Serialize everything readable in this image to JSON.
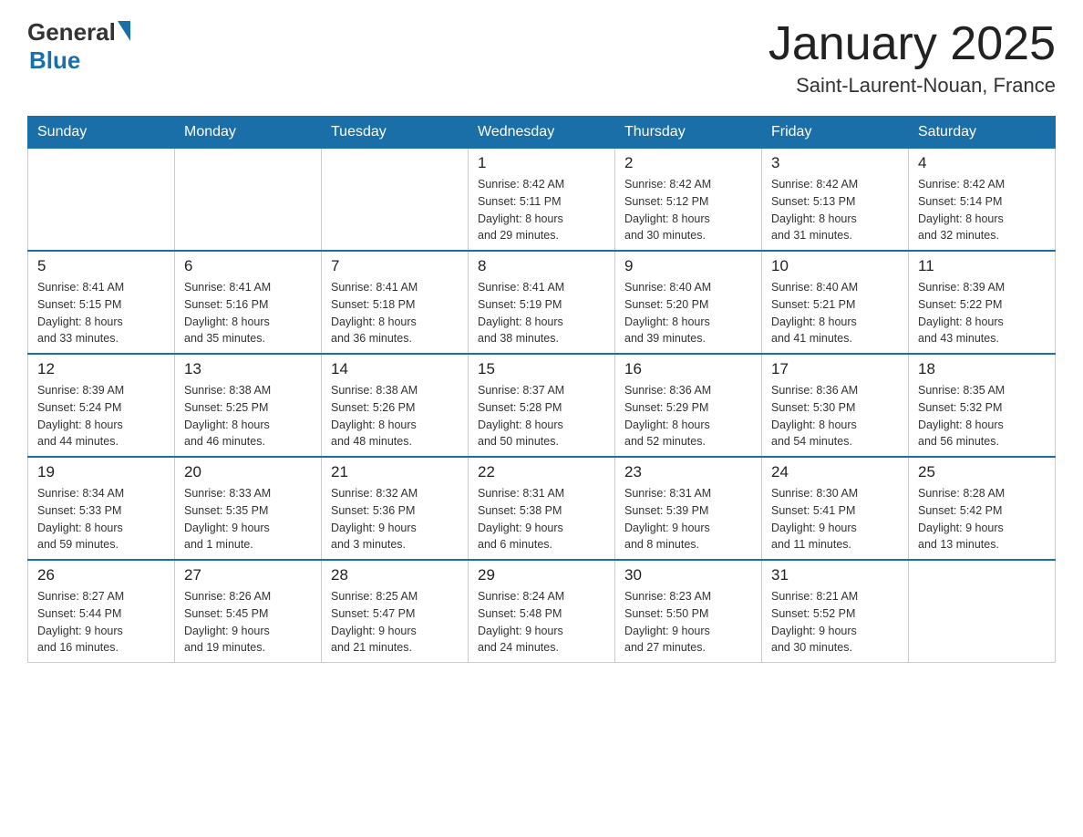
{
  "header": {
    "logo_general": "General",
    "logo_blue": "Blue",
    "month": "January 2025",
    "location": "Saint-Laurent-Nouan, France"
  },
  "days_of_week": [
    "Sunday",
    "Monday",
    "Tuesday",
    "Wednesday",
    "Thursday",
    "Friday",
    "Saturday"
  ],
  "weeks": [
    [
      {
        "day": "",
        "info": ""
      },
      {
        "day": "",
        "info": ""
      },
      {
        "day": "",
        "info": ""
      },
      {
        "day": "1",
        "info": "Sunrise: 8:42 AM\nSunset: 5:11 PM\nDaylight: 8 hours\nand 29 minutes."
      },
      {
        "day": "2",
        "info": "Sunrise: 8:42 AM\nSunset: 5:12 PM\nDaylight: 8 hours\nand 30 minutes."
      },
      {
        "day": "3",
        "info": "Sunrise: 8:42 AM\nSunset: 5:13 PM\nDaylight: 8 hours\nand 31 minutes."
      },
      {
        "day": "4",
        "info": "Sunrise: 8:42 AM\nSunset: 5:14 PM\nDaylight: 8 hours\nand 32 minutes."
      }
    ],
    [
      {
        "day": "5",
        "info": "Sunrise: 8:41 AM\nSunset: 5:15 PM\nDaylight: 8 hours\nand 33 minutes."
      },
      {
        "day": "6",
        "info": "Sunrise: 8:41 AM\nSunset: 5:16 PM\nDaylight: 8 hours\nand 35 minutes."
      },
      {
        "day": "7",
        "info": "Sunrise: 8:41 AM\nSunset: 5:18 PM\nDaylight: 8 hours\nand 36 minutes."
      },
      {
        "day": "8",
        "info": "Sunrise: 8:41 AM\nSunset: 5:19 PM\nDaylight: 8 hours\nand 38 minutes."
      },
      {
        "day": "9",
        "info": "Sunrise: 8:40 AM\nSunset: 5:20 PM\nDaylight: 8 hours\nand 39 minutes."
      },
      {
        "day": "10",
        "info": "Sunrise: 8:40 AM\nSunset: 5:21 PM\nDaylight: 8 hours\nand 41 minutes."
      },
      {
        "day": "11",
        "info": "Sunrise: 8:39 AM\nSunset: 5:22 PM\nDaylight: 8 hours\nand 43 minutes."
      }
    ],
    [
      {
        "day": "12",
        "info": "Sunrise: 8:39 AM\nSunset: 5:24 PM\nDaylight: 8 hours\nand 44 minutes."
      },
      {
        "day": "13",
        "info": "Sunrise: 8:38 AM\nSunset: 5:25 PM\nDaylight: 8 hours\nand 46 minutes."
      },
      {
        "day": "14",
        "info": "Sunrise: 8:38 AM\nSunset: 5:26 PM\nDaylight: 8 hours\nand 48 minutes."
      },
      {
        "day": "15",
        "info": "Sunrise: 8:37 AM\nSunset: 5:28 PM\nDaylight: 8 hours\nand 50 minutes."
      },
      {
        "day": "16",
        "info": "Sunrise: 8:36 AM\nSunset: 5:29 PM\nDaylight: 8 hours\nand 52 minutes."
      },
      {
        "day": "17",
        "info": "Sunrise: 8:36 AM\nSunset: 5:30 PM\nDaylight: 8 hours\nand 54 minutes."
      },
      {
        "day": "18",
        "info": "Sunrise: 8:35 AM\nSunset: 5:32 PM\nDaylight: 8 hours\nand 56 minutes."
      }
    ],
    [
      {
        "day": "19",
        "info": "Sunrise: 8:34 AM\nSunset: 5:33 PM\nDaylight: 8 hours\nand 59 minutes."
      },
      {
        "day": "20",
        "info": "Sunrise: 8:33 AM\nSunset: 5:35 PM\nDaylight: 9 hours\nand 1 minute."
      },
      {
        "day": "21",
        "info": "Sunrise: 8:32 AM\nSunset: 5:36 PM\nDaylight: 9 hours\nand 3 minutes."
      },
      {
        "day": "22",
        "info": "Sunrise: 8:31 AM\nSunset: 5:38 PM\nDaylight: 9 hours\nand 6 minutes."
      },
      {
        "day": "23",
        "info": "Sunrise: 8:31 AM\nSunset: 5:39 PM\nDaylight: 9 hours\nand 8 minutes."
      },
      {
        "day": "24",
        "info": "Sunrise: 8:30 AM\nSunset: 5:41 PM\nDaylight: 9 hours\nand 11 minutes."
      },
      {
        "day": "25",
        "info": "Sunrise: 8:28 AM\nSunset: 5:42 PM\nDaylight: 9 hours\nand 13 minutes."
      }
    ],
    [
      {
        "day": "26",
        "info": "Sunrise: 8:27 AM\nSunset: 5:44 PM\nDaylight: 9 hours\nand 16 minutes."
      },
      {
        "day": "27",
        "info": "Sunrise: 8:26 AM\nSunset: 5:45 PM\nDaylight: 9 hours\nand 19 minutes."
      },
      {
        "day": "28",
        "info": "Sunrise: 8:25 AM\nSunset: 5:47 PM\nDaylight: 9 hours\nand 21 minutes."
      },
      {
        "day": "29",
        "info": "Sunrise: 8:24 AM\nSunset: 5:48 PM\nDaylight: 9 hours\nand 24 minutes."
      },
      {
        "day": "30",
        "info": "Sunrise: 8:23 AM\nSunset: 5:50 PM\nDaylight: 9 hours\nand 27 minutes."
      },
      {
        "day": "31",
        "info": "Sunrise: 8:21 AM\nSunset: 5:52 PM\nDaylight: 9 hours\nand 30 minutes."
      },
      {
        "day": "",
        "info": ""
      }
    ]
  ]
}
